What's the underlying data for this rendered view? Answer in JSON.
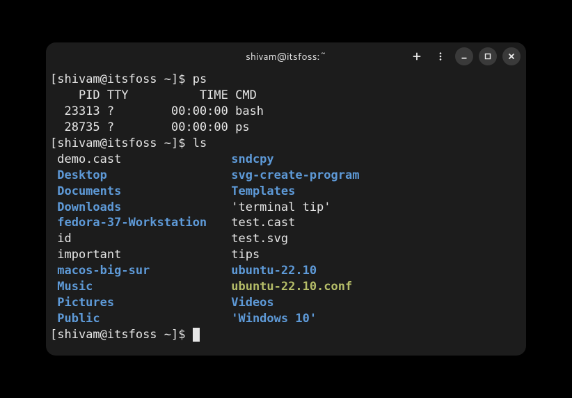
{
  "titlebar": {
    "title": "shivam@itsfoss:~"
  },
  "prompt": {
    "user_host": "shivam@itsfoss",
    "path": "~",
    "symbol": "$"
  },
  "session": {
    "cmd1": "ps",
    "ps_header": "    PID TTY          TIME CMD",
    "ps_row1": "  23313 ?        00:00:00 bash",
    "ps_row2": "  28735 ?        00:00:00 ps",
    "cmd2": "ls",
    "ls": [
      {
        "c1": {
          "t": "demo.cast",
          "k": "file"
        },
        "c2": {
          "t": "sndcpy",
          "k": "dir"
        }
      },
      {
        "c1": {
          "t": "Desktop",
          "k": "dir"
        },
        "c2": {
          "t": "svg-create-program",
          "k": "dir"
        }
      },
      {
        "c1": {
          "t": "Documents",
          "k": "dir"
        },
        "c2": {
          "t": "Templates",
          "k": "dir"
        }
      },
      {
        "c1": {
          "t": "Downloads",
          "k": "dir"
        },
        "c2": {
          "t": "'terminal tip'",
          "k": "file"
        }
      },
      {
        "c1": {
          "t": "fedora-37-Workstation",
          "k": "dir"
        },
        "c2": {
          "t": "test.cast",
          "k": "file"
        }
      },
      {
        "c1": {
          "t": "id",
          "k": "file"
        },
        "c2": {
          "t": "test.svg",
          "k": "file"
        }
      },
      {
        "c1": {
          "t": "important",
          "k": "file"
        },
        "c2": {
          "t": "tips",
          "k": "file"
        }
      },
      {
        "c1": {
          "t": "macos-big-sur",
          "k": "dir"
        },
        "c2": {
          "t": "ubuntu-22.10",
          "k": "dir"
        }
      },
      {
        "c1": {
          "t": "Music",
          "k": "dir"
        },
        "c2": {
          "t": "ubuntu-22.10.conf",
          "k": "exe"
        }
      },
      {
        "c1": {
          "t": "Pictures",
          "k": "dir"
        },
        "c2": {
          "t": "Videos",
          "k": "dir"
        }
      },
      {
        "c1": {
          "t": "Public",
          "k": "dir"
        },
        "c2": {
          "t": "'Windows 10'",
          "k": "quoted"
        }
      }
    ]
  }
}
